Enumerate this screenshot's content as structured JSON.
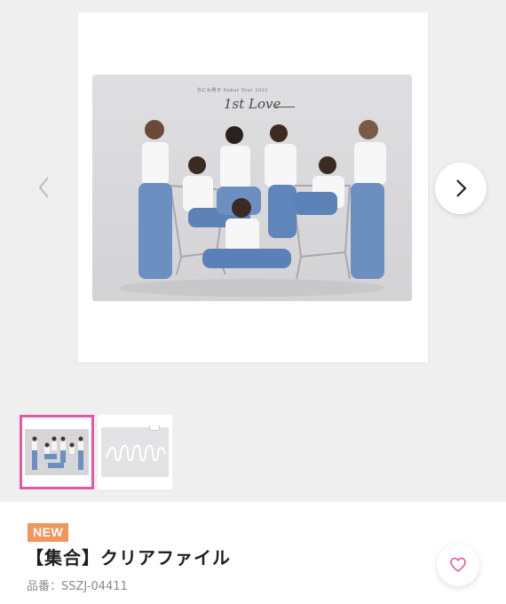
{
  "gallery": {
    "photo_caption_small": "なにわ男子  Debut Tour 2022",
    "photo_caption_script": "1st Love",
    "prev_icon": "chevron-left-icon",
    "next_icon": "chevron-right-icon",
    "thumbnails": [
      {
        "name": "group-photo-thumbnail",
        "selected": true
      },
      {
        "name": "clear-file-back-thumbnail",
        "selected": false
      }
    ],
    "colors": {
      "selected_border": "#e05aa4",
      "background": "#efefef"
    }
  },
  "product": {
    "badge": "NEW",
    "title": "【集合】クリアファイル",
    "code": "品番：SSZJ-04411",
    "favorite_icon": "heart-outline-icon",
    "colors": {
      "badge": "#f0955b",
      "heart": "#e05aa4"
    }
  }
}
